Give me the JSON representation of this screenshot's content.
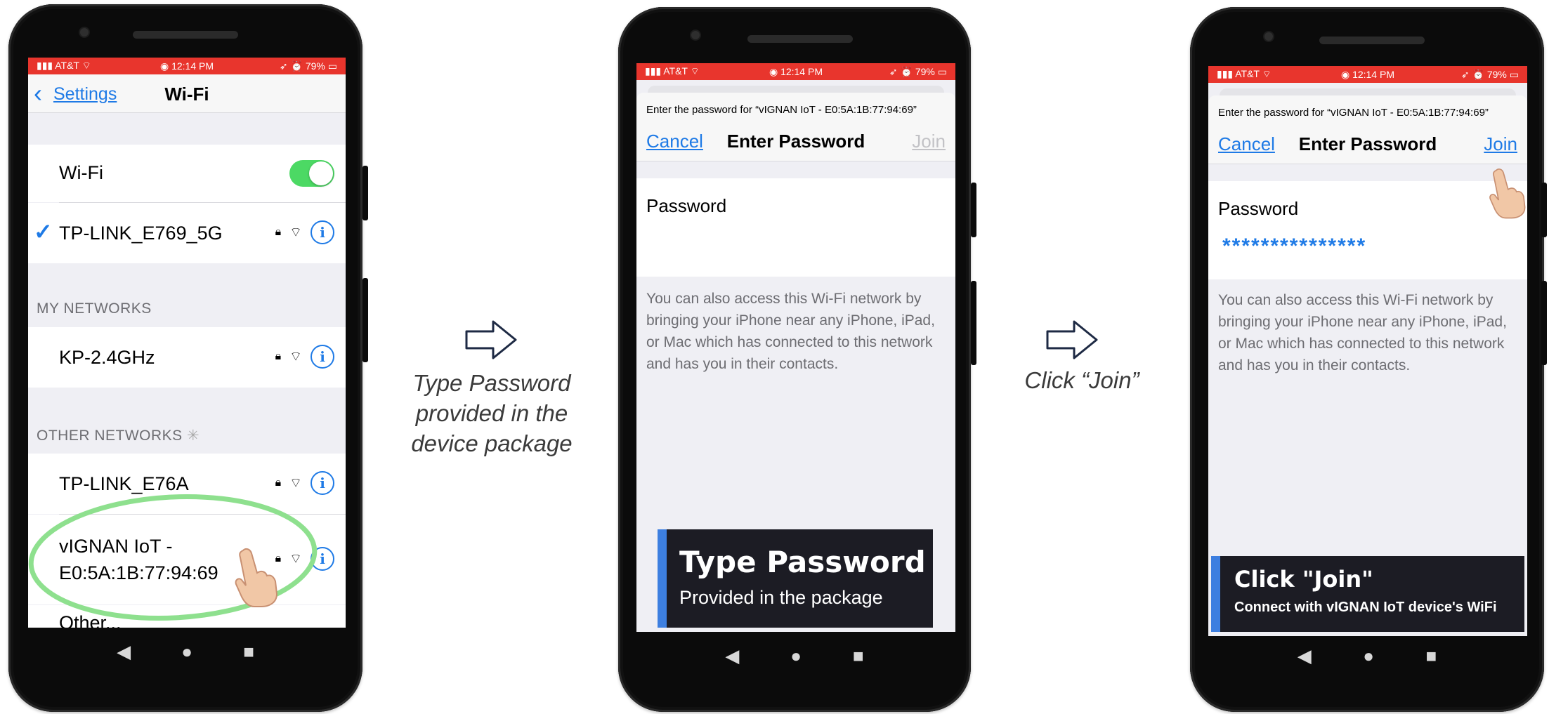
{
  "status_bar": {
    "carrier": "AT&T",
    "time": "12:14 PM",
    "battery": "79%"
  },
  "screen1": {
    "back_label": "Settings",
    "title": "Wi-Fi",
    "wifi_label": "Wi-Fi",
    "connected_network": "TP-LINK_E769_5G",
    "my_networks_header": "MY NETWORKS",
    "my_networks": [
      "KP-2.4GHz"
    ],
    "other_networks_header": "OTHER NETWORKS",
    "other_networks": [
      "TP-LINK_E76A",
      "vIGNAN IoT -\nE0:5A:1B:77:94:69",
      "Other..."
    ]
  },
  "screen2": {
    "prompt": "Enter the password for “vIGNAN IoT - E0:5A:1B:77:94:69”",
    "cancel": "Cancel",
    "title": "Enter Password",
    "join": "Join",
    "password_label": "Password",
    "password_value": "",
    "help_text": "You can also access this Wi-Fi network by bringing your iPhone near any iPhone, iPad, or Mac which has connected to this network and has you in their contacts.",
    "caption_title": "Type Password",
    "caption_sub": "Provided in the package"
  },
  "screen3": {
    "prompt": "Enter the password for “vIGNAN IoT - E0:5A:1B:77:94:69”",
    "cancel": "Cancel",
    "title": "Enter Password",
    "join": "Join",
    "password_label": "Password",
    "password_value": "***************",
    "help_text": "You can also access this Wi-Fi network by bringing your iPhone near any iPhone, iPad, or Mac which has connected to this network and has you in their contacts.",
    "caption_title": "Click \"Join\"",
    "caption_sub": "Connect with vIGNAN IoT device's WiFi"
  },
  "step1_text": "Type Password\nprovided in the\ndevice package",
  "step2_text": "Click “Join”",
  "colors": {
    "status": "#e8352d",
    "ios_blue": "#1e7ae6",
    "toggle": "#4cd964",
    "highlight": "#8ee08e",
    "caption_bg": "#1c1c24",
    "caption_accent": "#3d7fe0"
  },
  "icons": [
    "back-chevron-icon",
    "checkmark-icon",
    "lock-icon",
    "wifi-icon",
    "info-icon",
    "spinner-icon",
    "pointing-hand-icon",
    "arrow-right-icon",
    "back-triangle-icon",
    "home-circle-icon",
    "recents-square-icon"
  ]
}
